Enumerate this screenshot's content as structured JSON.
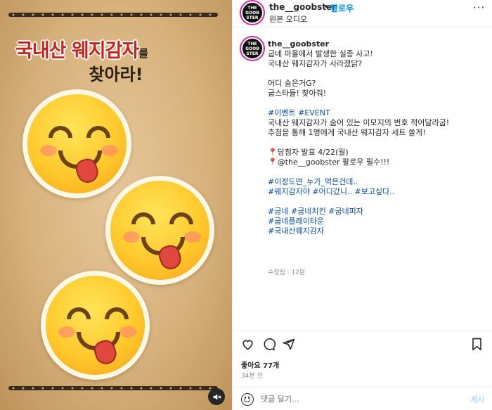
{
  "media": {
    "headline_main": "국내산 웨지감자",
    "headline_suffix": "를",
    "headline_line2": "찾아라!",
    "mute_icon": "speaker-muted-icon"
  },
  "header": {
    "avatar_text": [
      "THE",
      "GOOB",
      "STER"
    ],
    "username": "the__goobster",
    "separator": "•",
    "follow_label": "팔로우",
    "audio_label": "원본 오디오",
    "more_icon": "···"
  },
  "caption": {
    "username": "the__goobster",
    "lines": [
      "굽네 마을에서 발생한 실종 사고!",
      "국내산 웨지감자가 사라졌닭?",
      "",
      "어디 숨은거G?",
      "굽스타들! 찾아줘!",
      "",
      "#이벤트 #EVENT",
      "국내산 웨지감자가 숨어 있는 이모지의 번호 적어달라굽!",
      "추첨을 통해 1명에게 국내산 웨지감자 세트 쏠게!",
      "",
      "📍당첨자 발표 4/22(월)",
      "📍@the__goobster 팔로우 필수!!!",
      "",
      "#이정도면_누가_먹은건데..",
      "#웨지감자야 #어디갔니.. #보고싶다..",
      "",
      "#굽네 #굽네치킨 #굽네피자",
      "#굽네플레이타운",
      "#국내산웨지감자"
    ],
    "meta": "수정됨 · 12분"
  },
  "actions": {
    "like_icon": "heart-icon",
    "comment_icon": "comment-icon",
    "share_icon": "send-icon",
    "save_icon": "bookmark-icon"
  },
  "likes": "좋아요 77개",
  "time_ago": "34분 전",
  "comment_box": {
    "placeholder": "댓글 달기...",
    "post_label": "게시"
  }
}
